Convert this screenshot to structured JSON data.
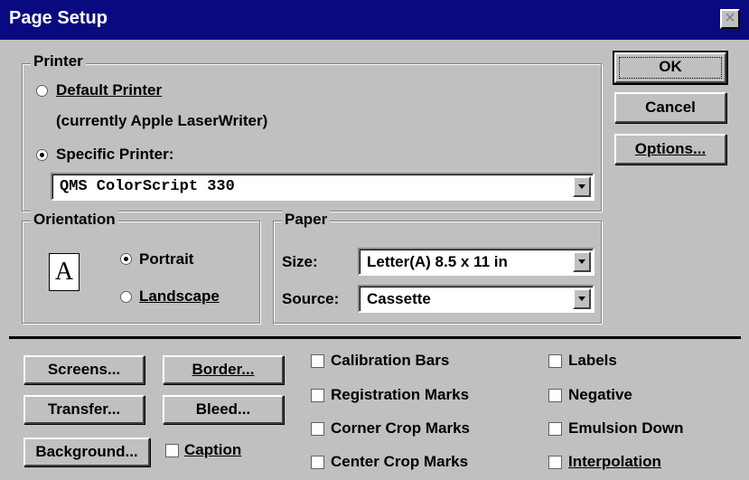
{
  "window": {
    "title": "Page Setup",
    "close_glyph": "✕"
  },
  "printer": {
    "group_label": "Printer",
    "default_label": "Default Printer",
    "default_note": "(currently Apple LaserWriter)",
    "specific_label": "Specific Printer:",
    "selected": "specific",
    "printer_value": "QMS ColorScript 330"
  },
  "orientation": {
    "group_label": "Orientation",
    "portrait_label": "Portrait",
    "landscape_label": "Landscape",
    "selected": "portrait",
    "icon_letter": "A"
  },
  "paper": {
    "group_label": "Paper",
    "size_label": "Size:",
    "size_value": "Letter(A) 8.5 x 11 in",
    "source_label": "Source:",
    "source_value": "Cassette"
  },
  "side_buttons": {
    "ok": "OK",
    "cancel": "Cancel",
    "options": "Options..."
  },
  "bottom_buttons": {
    "screens": "Screens...",
    "border": "Border...",
    "transfer": "Transfer...",
    "bleed": "Bleed...",
    "background": "Background..."
  },
  "checkboxes": {
    "caption": "Caption",
    "calibration_bars": "Calibration Bars",
    "registration_marks": "Registration Marks",
    "corner_crop_marks": "Corner Crop Marks",
    "center_crop_marks": "Center Crop Marks",
    "labels": "Labels",
    "negative": "Negative",
    "emulsion_down": "Emulsion Down",
    "interpolation": "Interpolation"
  },
  "colors": {
    "title_bar": "#0a0a80",
    "dialog_face": "#c0c0c0"
  }
}
